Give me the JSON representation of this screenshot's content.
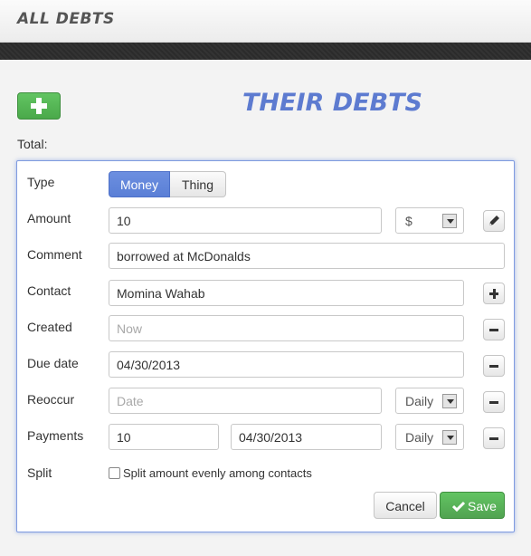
{
  "header": {
    "title": "ALL DEBTS"
  },
  "page": {
    "heading": "THEIR DEBTS",
    "total_label": "Total:"
  },
  "form": {
    "type": {
      "label": "Type",
      "options": [
        "Money",
        "Thing"
      ],
      "selected": "Money"
    },
    "amount": {
      "label": "Amount",
      "value": "10",
      "currency": "$"
    },
    "comment": {
      "label": "Comment",
      "value": "borrowed at McDonalds"
    },
    "contact": {
      "label": "Contact",
      "value": "Momina Wahab"
    },
    "created": {
      "label": "Created",
      "placeholder": "Now"
    },
    "due_date": {
      "label": "Due date",
      "value": "04/30/2013"
    },
    "reoccur": {
      "label": "Reoccur",
      "placeholder": "Date",
      "frequency": "Daily"
    },
    "payments": {
      "label": "Payments",
      "amount": "10",
      "date": "04/30/2013",
      "frequency": "Daily"
    },
    "split": {
      "label": "Split",
      "checkbox_label": "Split amount evenly among contacts",
      "checked": false
    },
    "actions": {
      "cancel": "Cancel",
      "save": "Save"
    }
  },
  "colors": {
    "accent": "#5a7fd6",
    "success": "#5bb75b",
    "heading": "#5d7bd0"
  },
  "icons": [
    "plus-icon",
    "pencil-icon",
    "minus-icon",
    "check-icon",
    "chevron-down-icon"
  ]
}
